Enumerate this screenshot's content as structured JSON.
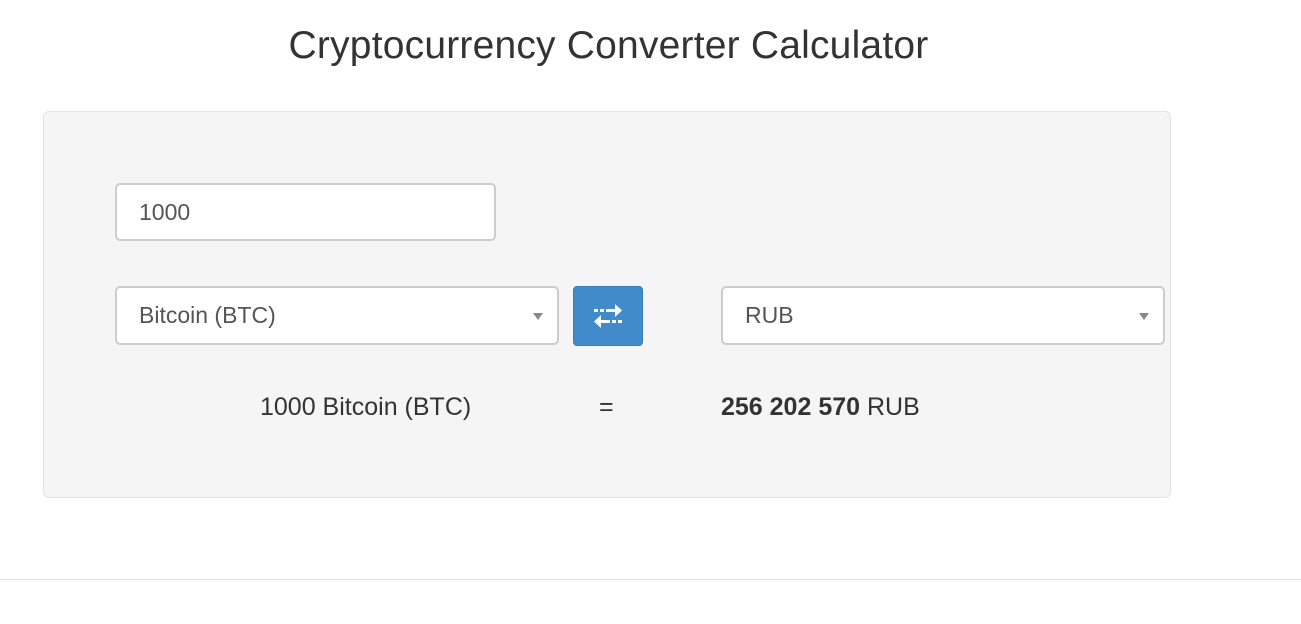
{
  "page": {
    "title": "Cryptocurrency Converter Calculator"
  },
  "converter": {
    "amount": "1000",
    "from_currency": "Bitcoin (BTC)",
    "to_currency": "RUB",
    "swap_icon": "swap-arrows-icon",
    "result_from": "1000 Bitcoin (BTC)",
    "equals": "=",
    "result_value": "256 202 570",
    "result_currency": "RUB"
  },
  "colors": {
    "accent": "#428bca",
    "panel_bg": "#f5f5f5"
  }
}
